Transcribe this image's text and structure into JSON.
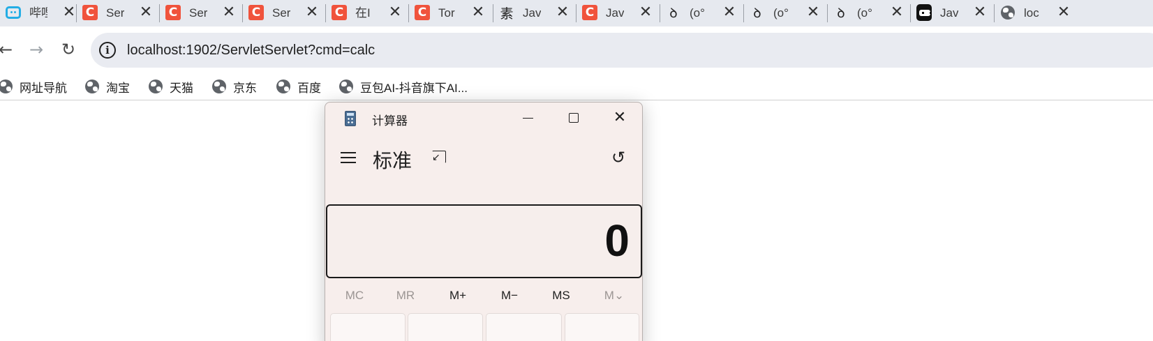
{
  "browser": {
    "tabs": [
      {
        "favicon": "bilibili-tv-icon",
        "title": "哔哩",
        "close": "✕"
      },
      {
        "favicon": "csdn-c-icon",
        "title": "Ser",
        "close": "✕"
      },
      {
        "favicon": "csdn-c-icon",
        "title": "Ser",
        "close": "✕"
      },
      {
        "favicon": "csdn-c-icon",
        "title": "Ser",
        "close": "✕"
      },
      {
        "favicon": "csdn-c-icon",
        "title": "在I",
        "close": "✕"
      },
      {
        "favicon": "csdn-c-icon",
        "title": "Tor",
        "close": "✕"
      },
      {
        "favicon": "su-glyph-icon",
        "title": "Jav",
        "close": "✕"
      },
      {
        "favicon": "csdn-c-icon",
        "title": "Jav",
        "close": "✕"
      },
      {
        "favicon": "lambda-glyph-icon",
        "title": "(o°",
        "close": "✕"
      },
      {
        "favicon": "lambda-glyph-icon",
        "title": "(o°",
        "close": "✕"
      },
      {
        "favicon": "lambda-glyph-icon",
        "title": "(o°",
        "close": "✕"
      },
      {
        "favicon": "robot-icon",
        "title": "Jav",
        "close": "✕"
      },
      {
        "favicon": "globe-icon",
        "title": "loc",
        "close": "✕"
      }
    ],
    "glyphs": {
      "su": "素",
      "lambda": "ꝺ",
      "csdn": "C"
    },
    "nav": {
      "back": "←",
      "forward": "→",
      "reload": "↻",
      "info": "i"
    },
    "url": "localhost:1902/ServletServlet?cmd=calc",
    "bookmarks": [
      "网址导航",
      "淘宝",
      "天猫",
      "京东",
      "百度",
      "豆包AI-抖音旗下AI..."
    ]
  },
  "calculator": {
    "window_title": "计算器",
    "window_close": "✕",
    "mode": "标准",
    "history_icon": "↺",
    "display": "0",
    "memory": [
      {
        "label": "MC",
        "enabled": false
      },
      {
        "label": "MR",
        "enabled": false
      },
      {
        "label": "M+",
        "enabled": true
      },
      {
        "label": "M−",
        "enabled": true
      },
      {
        "label": "MS",
        "enabled": true
      },
      {
        "label": "M⌄",
        "enabled": false
      }
    ]
  },
  "colors": {
    "tab_strip": "#e6e9ef",
    "omnibox": "#e9ebf1",
    "csdn_red": "#f0533c",
    "bilibili_blue": "#23ade5",
    "calc_bg": "#f7eeec"
  }
}
